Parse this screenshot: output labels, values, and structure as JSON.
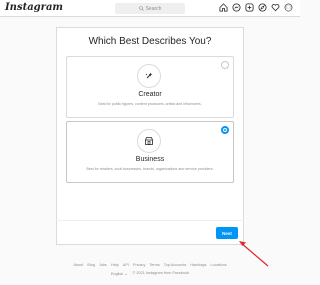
{
  "header": {
    "logo": "Instagram",
    "search_placeholder": "Search",
    "nav_icons": [
      "home-icon",
      "messenger-icon",
      "explore-icon",
      "compass-icon",
      "heart-icon",
      "avatar"
    ]
  },
  "main": {
    "title": "Which Best Describes You?",
    "options": [
      {
        "icon": "sparkle-icon",
        "label": "Creator",
        "description": "Best for public figures, content producers, artists and influencers.",
        "selected": false
      },
      {
        "icon": "shop-icon",
        "label": "Business",
        "description": "Best for retailers, local businesses, brands, organizations and service providers.",
        "selected": true
      }
    ],
    "next_label": "Next"
  },
  "footer": {
    "links": [
      "About",
      "Blog",
      "Jobs",
      "Help",
      "API",
      "Privacy",
      "Terms",
      "Top Accounts",
      "Hashtags",
      "Locations"
    ],
    "language": "English",
    "copyright": "© 2021 Instagram from Facebook"
  },
  "annotation": {
    "arrow_color": "#e0262f"
  }
}
